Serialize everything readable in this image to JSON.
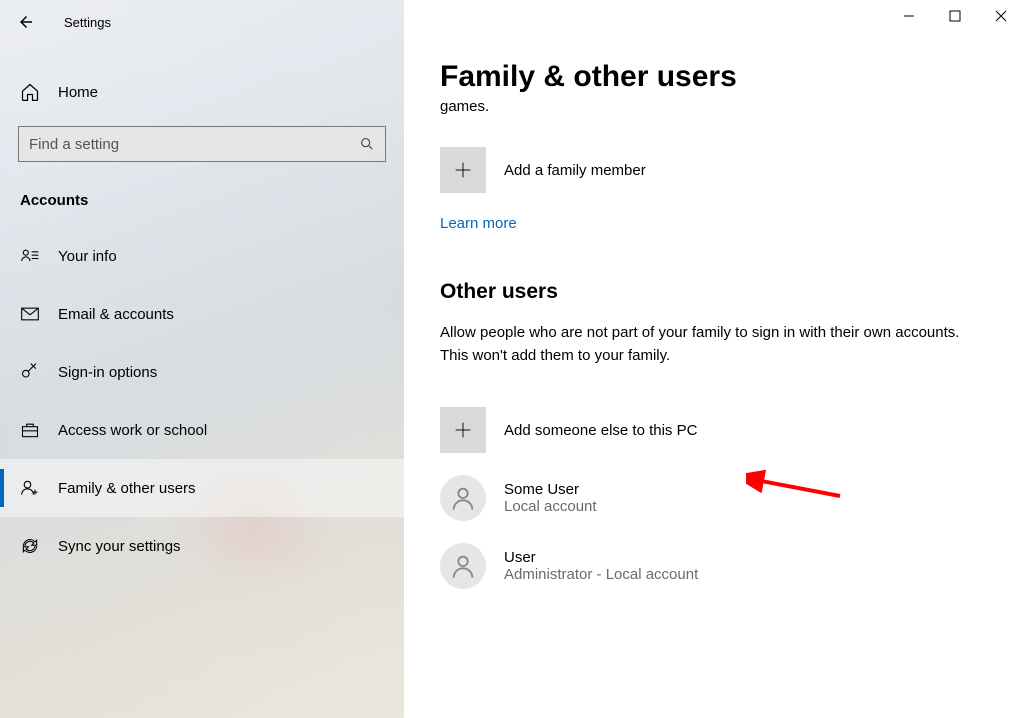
{
  "window": {
    "title": "Settings"
  },
  "sidebar": {
    "home_label": "Home",
    "search_placeholder": "Find a setting",
    "section_label": "Accounts",
    "items": [
      {
        "label": "Your info"
      },
      {
        "label": "Email & accounts"
      },
      {
        "label": "Sign-in options"
      },
      {
        "label": "Access work or school"
      },
      {
        "label": "Family & other users"
      },
      {
        "label": "Sync your settings"
      }
    ]
  },
  "main": {
    "title": "Family & other users",
    "stray_text": "games.",
    "add_family_label": "Add a family member",
    "learn_more": "Learn more",
    "other_users_heading": "Other users",
    "other_users_desc": "Allow people who are not part of your family to sign in with their own accounts. This won't add them to your family.",
    "add_other_label": "Add someone else to this PC",
    "users": [
      {
        "name": "Some User",
        "sub": "Local account"
      },
      {
        "name": "User",
        "sub": "Administrator - Local account"
      }
    ]
  }
}
